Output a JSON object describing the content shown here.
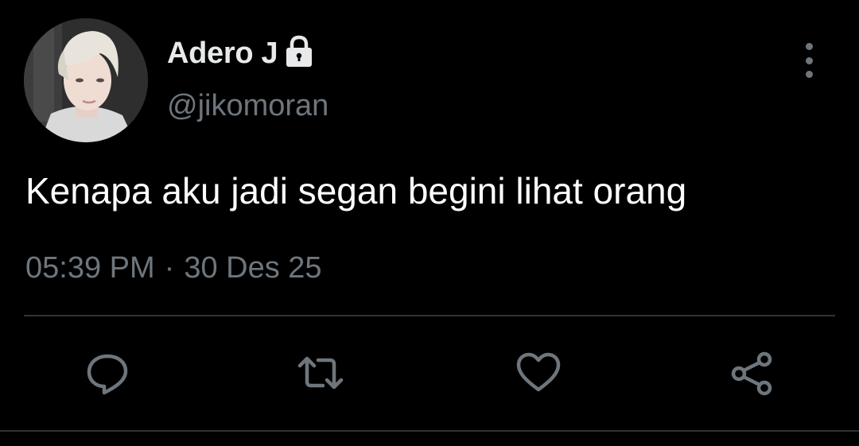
{
  "tweet": {
    "author": {
      "display_name": "Adero J",
      "handle": "@jikomoran",
      "protected_icon": "lock-icon",
      "avatar": "profile-photo"
    },
    "text": "Kenapa aku jadi segan begini lihat orang",
    "time": "05:39 PM",
    "separator": "·",
    "date": "30 Des 25"
  },
  "actions": [
    {
      "name": "reply",
      "icon": "comment-icon"
    },
    {
      "name": "retweet",
      "icon": "retweet-icon"
    },
    {
      "name": "like",
      "icon": "heart-icon"
    },
    {
      "name": "share",
      "icon": "share-icon"
    }
  ],
  "colors": {
    "background": "#000000",
    "primary_text": "#e7e9ea",
    "secondary_text": "#6e767d",
    "divider": "#2f3336"
  }
}
